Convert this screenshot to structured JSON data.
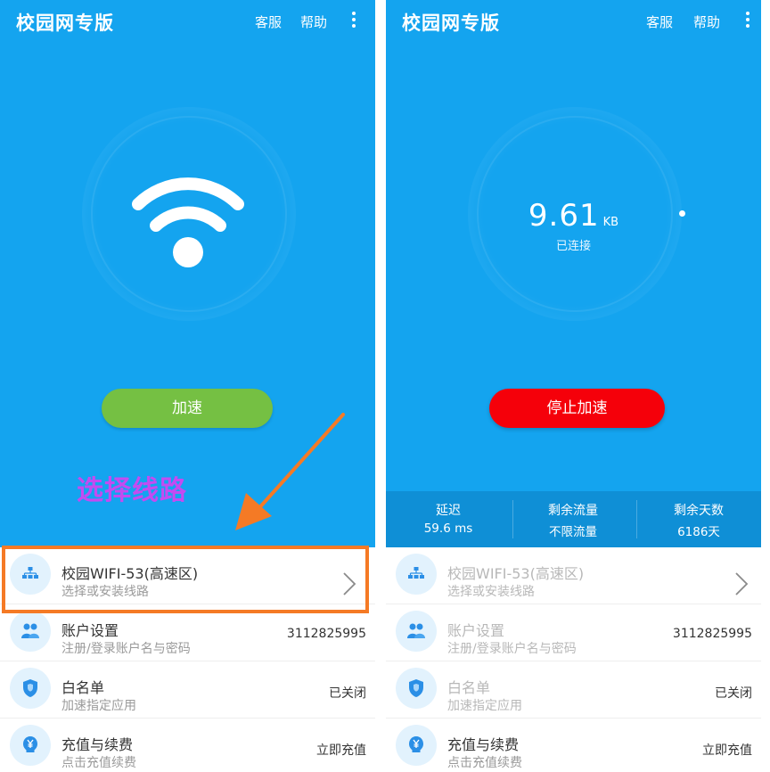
{
  "left": {
    "app_title": "校园网专版",
    "service_label": "客服",
    "help_label": "帮助",
    "accelerate_label": "加速",
    "annotation_text": "选择线路",
    "list": [
      {
        "title": "校园WIFI-53(高速区)",
        "subtitle": "选择或安装线路",
        "value": "",
        "icon": "network-route-icon"
      },
      {
        "title": "账户设置",
        "subtitle": "注册/登录账户名与密码",
        "value": "3112825995",
        "icon": "users-icon"
      },
      {
        "title": "白名单",
        "subtitle": "加速指定应用",
        "value": "已关闭",
        "icon": "shield-icon"
      },
      {
        "title": "充值与续费",
        "subtitle": "点击充值续费",
        "value": "立即充值",
        "icon": "yuan-coin-icon"
      }
    ]
  },
  "right": {
    "app_title": "校园网专版",
    "service_label": "客服",
    "help_label": "帮助",
    "speed_value": "9.61",
    "speed_unit": "KB",
    "status": "已连接",
    "stop_label": "停止加速",
    "stats": [
      {
        "label": "延迟",
        "value": "59.6 ms"
      },
      {
        "label": "剩余流量",
        "value": "不限流量"
      },
      {
        "label": "剩余天数",
        "value": "6186天"
      }
    ],
    "list": [
      {
        "title": "校园WIFI-53(高速区)",
        "subtitle": "选择或安装线路",
        "value": "",
        "icon": "network-route-icon"
      },
      {
        "title": "账户设置",
        "subtitle": "注册/登录账户名与密码",
        "value": "3112825995",
        "icon": "users-icon"
      },
      {
        "title": "白名单",
        "subtitle": "加速指定应用",
        "value": "已关闭",
        "icon": "shield-icon"
      },
      {
        "title": "充值与续费",
        "subtitle": "点击充值续费",
        "value": "立即充值",
        "icon": "yuan-coin-icon"
      }
    ]
  },
  "colors": {
    "primary_blue": "#14a4ef",
    "stats_blue": "#0f8fd6",
    "accelerate_green": "#75c043",
    "stop_red": "#f5000a",
    "annotation_purple": "#c44bf1",
    "annotation_orange": "#f57a25"
  }
}
